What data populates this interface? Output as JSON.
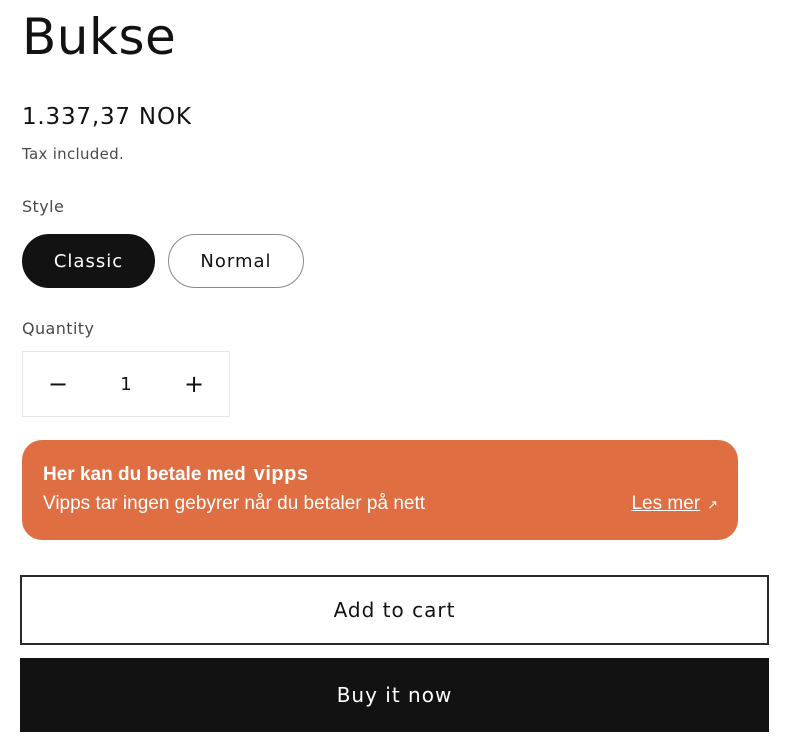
{
  "product": {
    "title": "Bukse",
    "price": "1.337,37 NOK",
    "tax_note": "Tax included."
  },
  "style": {
    "label": "Style",
    "options": [
      {
        "label": "Classic",
        "selected": true
      },
      {
        "label": "Normal",
        "selected": false
      }
    ]
  },
  "quantity": {
    "label": "Quantity",
    "value": "1",
    "decrease_symbol": "−",
    "increase_symbol": "+"
  },
  "vipps_banner": {
    "title": "Her kan du betale med",
    "logo_text": "vipps",
    "subtitle": "Vipps tar ingen gebyrer når du betaler på nett",
    "link_label": "Les mer",
    "link_icon": "external-arrow-icon",
    "background_color": "#e06e43"
  },
  "actions": {
    "add_to_cart": "Add to cart",
    "buy_now": "Buy it now"
  }
}
